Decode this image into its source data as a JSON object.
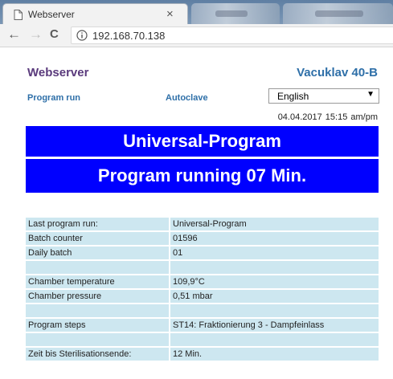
{
  "browser": {
    "tab_title": "Webserver",
    "tab_close": "×",
    "url": "192.168.70.138",
    "back_glyph": "←",
    "forward_glyph": "→",
    "reload_glyph": "C",
    "inactive_tabs": [
      "tab",
      "tab"
    ]
  },
  "header": {
    "title": "Webserver",
    "device": "Vacuklav  40-B"
  },
  "nav": {
    "program_run": "Program run",
    "autoclave": "Autoclave"
  },
  "language": {
    "selected": "English",
    "arrow": "▼"
  },
  "datetime": "04.04.2017   15:15 am/pm",
  "banner": {
    "program": "Universal-Program",
    "status": "Program running 07 Min."
  },
  "rows": [
    {
      "label": "Last program run:",
      "value": "Universal-Program"
    },
    {
      "label": "Batch counter",
      "value": "01596"
    },
    {
      "label": "Daily batch",
      "value": "01"
    },
    {
      "label": "",
      "value": ""
    },
    {
      "label": "Chamber temperature",
      "value": "109,9°C"
    },
    {
      "label": "Chamber pressure",
      "value": "0,51 mbar"
    },
    {
      "label": "",
      "value": ""
    },
    {
      "label": "Program steps",
      "value": "ST14: Fraktionierung 3 - Dampfeinlass"
    },
    {
      "label": "",
      "value": ""
    },
    {
      "label": "Zeit bis Sterilisationsende:",
      "value": "12 Min."
    }
  ],
  "colors": {
    "banner_bg": "#0000ff",
    "banner_text": "#ffffff",
    "row_bg": "#cde7f0",
    "title_color": "#5a3a7c",
    "link_color": "#2e6fa8"
  }
}
